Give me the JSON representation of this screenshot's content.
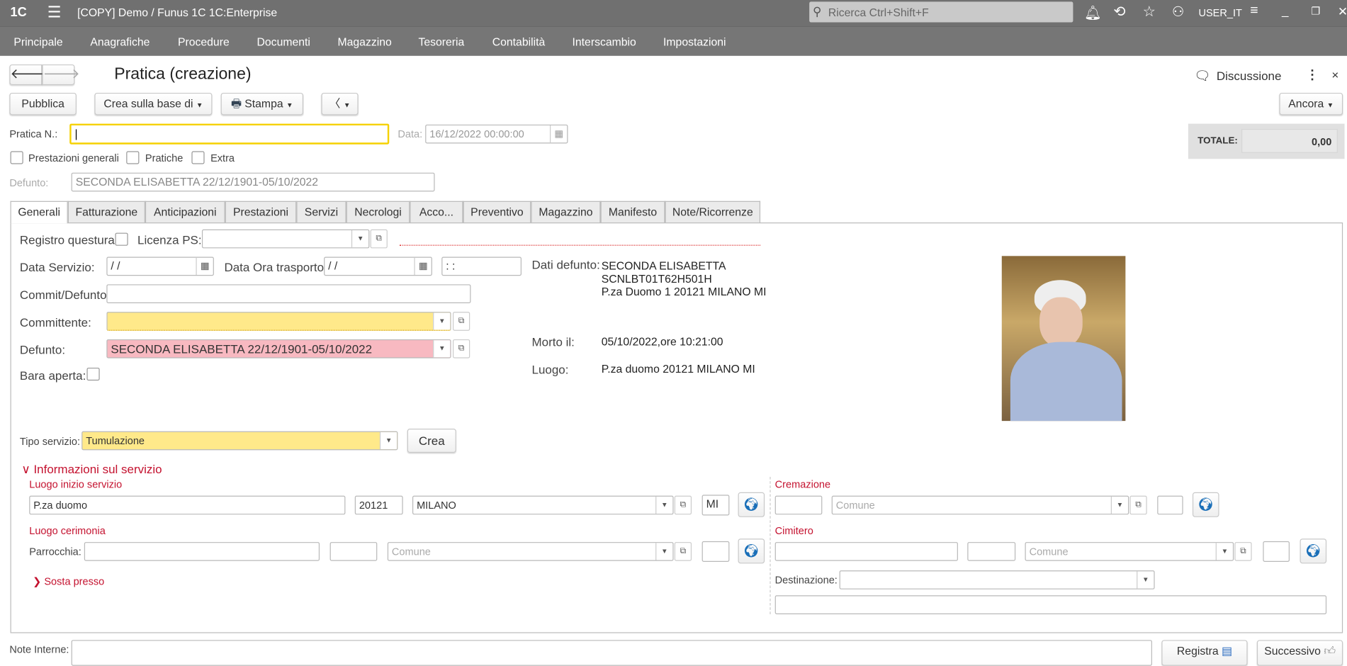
{
  "titlebar": {
    "logo": "1C",
    "title": "[COPY] Demo / Funus 1C 1C:Enterprise",
    "search_placeholder": "Ricerca Ctrl+Shift+F",
    "user": "USER_IT"
  },
  "menu": [
    "Principale",
    "Anagrafiche",
    "Procedure",
    "Documenti",
    "Magazzino",
    "Tesoreria",
    "Contabilità",
    "Interscambio",
    "Impostazioni"
  ],
  "form": {
    "title": "Pratica (creazione)",
    "discussion": "Discussione",
    "toolbar": {
      "publish": "Pubblica",
      "create_based": "Crea sulla base di",
      "print": "Stampa",
      "more_nav": "〈",
      "more": "Ancora"
    },
    "pratica_label": "Pratica N.:",
    "pratica_value": "",
    "data_label": "Data:",
    "data_value": "16/12/2022 00:00:00",
    "total_label": "TOTALE:",
    "total_value": "0,00",
    "checks": [
      {
        "label": "Prestazioni generali",
        "checked": false
      },
      {
        "label": "Pratiche",
        "checked": false
      },
      {
        "label": "Extra",
        "checked": false
      }
    ],
    "defunto_label": "Defunto:",
    "defunto_value": "SECONDA ELISABETTA 22/12/1901-05/10/2022"
  },
  "tabs": [
    "Generali",
    "Fatturazione",
    "Anticipazioni",
    "Prestazioni",
    "Servizi",
    "Necrologi",
    "Acco...",
    "Preventivo",
    "Magazzino",
    "Manifesto",
    "Note/Ricorrenze"
  ],
  "generali": {
    "registro_label": "Registro questura:",
    "licenza_label": "Licenza PS:",
    "licenza_value": "",
    "data_servizio_label": "Data Servizio:",
    "data_servizio_value": " /  /",
    "data_ora_label": "Data Ora trasporto:",
    "data_ora_value": " /  /",
    "time_value": " :  :",
    "commit_label": "Commit/Defunto:",
    "commit_value": "",
    "committente_label": "Committente:",
    "committente_value": "",
    "defunto_label": "Defunto:",
    "defunto_value": "SECONDA ELISABETTA 22/12/1901-05/10/2022",
    "bara_label": "Bara aperta:",
    "dati_label": "Dati defunto:",
    "dati_lines": [
      "SECONDA ELISABETTA",
      "SCNLBT01T62H501H",
      "P.za Duomo 1 20121 MILANO MI"
    ],
    "morto_label": "Morto il:",
    "morto_value": "05/10/2022,ore 10:21:00",
    "luogo_label": "Luogo:",
    "luogo_value": "P.za duomo 20121 MILANO MI",
    "tipo_label": "Tipo servizio:",
    "tipo_value": "Tumulazione",
    "crea": "Crea",
    "info_title": "Informazioni sul servizio",
    "inizio_title": "Luogo inizio servizio",
    "inizio": {
      "address": "P.za duomo",
      "cap": "20121",
      "comune": "MILANO",
      "prov": "MI"
    },
    "cremazione_title": "Cremazione",
    "comune_placeholder": "Comune",
    "cerimonia_title": "Luogo cerimonia",
    "parrocchia_label": "Parrocchia:",
    "cimitero_title": "Cimitero",
    "sosta_title": "Sosta presso",
    "destinazione_label": "Destinazione:"
  },
  "footer": {
    "note_label": "Note Interne:",
    "registra": "Registra",
    "successivo": "Successivo"
  },
  "colors": {
    "accent_red": "#c4122f",
    "required_yellow": "#ffe98a",
    "error_pink": "#f8b9c1"
  }
}
